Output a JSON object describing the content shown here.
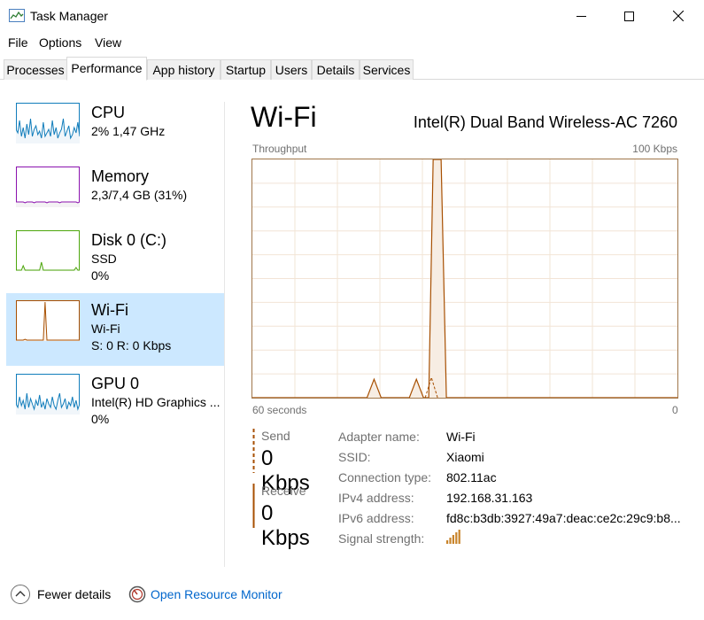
{
  "window": {
    "title": "Task Manager",
    "icon": "task-manager-icon"
  },
  "menu": [
    "File",
    "Options",
    "View"
  ],
  "tabs": [
    {
      "label": "Processes",
      "active": false
    },
    {
      "label": "Performance",
      "active": true
    },
    {
      "label": "App history",
      "active": false
    },
    {
      "label": "Startup",
      "active": false
    },
    {
      "label": "Users",
      "active": false
    },
    {
      "label": "Details",
      "active": false
    },
    {
      "label": "Services",
      "active": false
    }
  ],
  "resources": [
    {
      "name": "CPU",
      "sub1": "2% 1,47 GHz",
      "sub2": "",
      "color": "#117dbb",
      "fill": "#f1f6fa",
      "selected": false
    },
    {
      "name": "Memory",
      "sub1": "2,3/7,4 GB (31%)",
      "sub2": "",
      "color": "#8b12ae",
      "fill": "#f4f2f4",
      "selected": false
    },
    {
      "name": "Disk 0 (C:)",
      "sub1": "SSD",
      "sub2": "0%",
      "color": "#4da60c",
      "fill": "#eff7ea",
      "selected": false
    },
    {
      "name": "Wi-Fi",
      "sub1": "Wi-Fi",
      "sub2": "S: 0 R: 0 Kbps",
      "color": "#a74f01",
      "fill": "#fcf3eb",
      "selected": true
    },
    {
      "name": "GPU 0",
      "sub1": "Intel(R) HD Graphics ...",
      "sub2": "0%",
      "color": "#117dbb",
      "fill": "#f1f6fa",
      "selected": false
    }
  ],
  "detail": {
    "title": "Wi-Fi",
    "device": "Intel(R) Dual Band Wireless-AC 7260",
    "chart_label_left": "Throughput",
    "chart_label_right": "100 Kbps",
    "time_label_left": "60 seconds",
    "time_label_right": "0",
    "send_label": "Send",
    "send_value": "0 Kbps",
    "receive_label": "Receive",
    "receive_value": "0 Kbps",
    "properties": [
      {
        "key": "Adapter name:",
        "value": "Wi-Fi"
      },
      {
        "key": "SSID:",
        "value": "Xiaomi"
      },
      {
        "key": "Connection type:",
        "value": "802.11ac"
      },
      {
        "key": "IPv4 address:",
        "value": "192.168.31.163"
      },
      {
        "key": "IPv6 address:",
        "value": "fd8c:b3db:3927:49a7:deac:ce2c:29c9:b8..."
      },
      {
        "key": "Signal strength:",
        "value": ""
      }
    ],
    "signal_bars": 5,
    "accent": "#a74f01"
  },
  "footer": {
    "fewer_details": "Fewer details",
    "open_monitor": "Open Resource Monitor"
  }
}
